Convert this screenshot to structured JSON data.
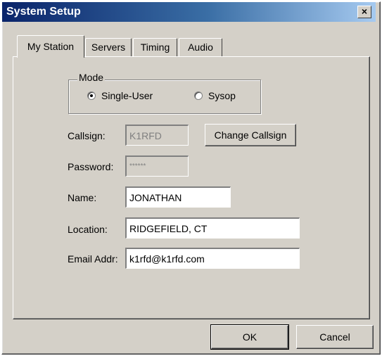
{
  "window": {
    "title": "System Setup",
    "close_symbol": "×"
  },
  "tabs": [
    {
      "label": "My Station",
      "active": true
    },
    {
      "label": "Servers",
      "active": false
    },
    {
      "label": "Timing",
      "active": false
    },
    {
      "label": "Audio",
      "active": false
    }
  ],
  "mode": {
    "label": "Mode",
    "options": [
      {
        "label": "Single-User",
        "checked": true
      },
      {
        "label": "Sysop",
        "checked": false
      }
    ]
  },
  "form": {
    "callsign": {
      "label": "Callsign:",
      "value": "K1RFD"
    },
    "change_callsign_button": "Change Callsign",
    "password": {
      "label": "Password:",
      "value": "******"
    },
    "name": {
      "label": "Name:",
      "value": "JONATHAN"
    },
    "location": {
      "label": "Location:",
      "value": "RIDGEFIELD, CT"
    },
    "email": {
      "label": "Email Addr:",
      "value": "k1rfd@k1rfd.com"
    }
  },
  "buttons": {
    "ok": "OK",
    "cancel": "Cancel"
  }
}
